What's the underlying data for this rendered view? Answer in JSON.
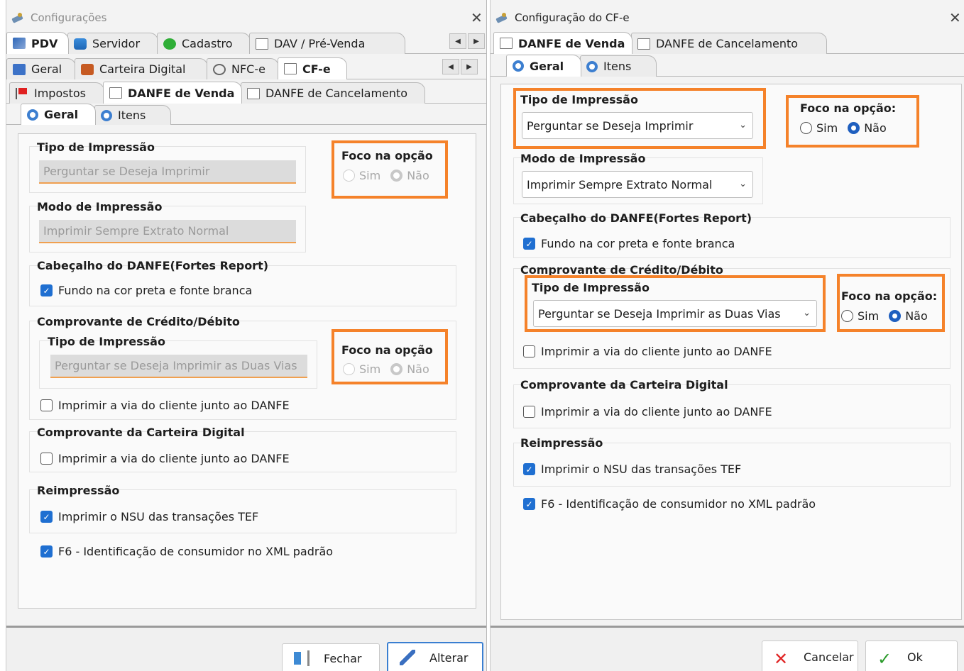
{
  "left": {
    "title": "Configurações",
    "close_glyph": "✕",
    "tabs_row1": [
      "PDV",
      "Servidor",
      "Cadastro",
      "DAV / Pré-Venda"
    ],
    "tabs_row2": [
      "Geral",
      "Carteira Digital",
      "NFC-e",
      "CF-e"
    ],
    "tabs_row3": [
      "Impostos",
      "DANFE de Venda",
      "DANFE de Cancelamento"
    ],
    "tabs_row4": [
      "Geral",
      "Itens"
    ],
    "tipo_impressao": {
      "label": "Tipo de Impressão",
      "value": "Perguntar se Deseja Imprimir"
    },
    "foco1": {
      "label": "Foco na opção",
      "sim": "Sim",
      "nao": "Não"
    },
    "modo_impressao": {
      "label": "Modo de Impressão",
      "value": "Imprimir Sempre Extrato Normal"
    },
    "cabecalho": {
      "label": "Cabeçalho do DANFE(Fortes Report)",
      "check": "Fundo na cor preta e fonte branca"
    },
    "credito": {
      "label": "Comprovante de Crédito/Débito",
      "tipo_label": "Tipo de Impressão",
      "tipo_value": "Perguntar se Deseja Imprimir as Duas Vias",
      "check": "Imprimir a via do cliente junto ao DANFE"
    },
    "foco2": {
      "label": "Foco na opção",
      "sim": "Sim",
      "nao": "Não"
    },
    "carteira": {
      "label": "Comprovante da Carteira Digital",
      "check": "Imprimir a via do cliente junto ao DANFE"
    },
    "reimpressao": {
      "label": "Reimpressão",
      "check": "Imprimir o NSU das transações TEF"
    },
    "f6": "F6 - Identificação de consumidor no XML padrão",
    "buttons": {
      "fechar": "Fechar",
      "alterar": "Alterar"
    }
  },
  "right": {
    "title": "Configuração do CF-e",
    "close_glyph": "✕",
    "tabs_row1": [
      "DANFE de Venda",
      "DANFE de Cancelamento"
    ],
    "tabs_row2": [
      "Geral",
      "Itens"
    ],
    "tipo_impressao": {
      "label": "Tipo de Impressão",
      "value": "Perguntar se Deseja Imprimir"
    },
    "foco1": {
      "label": "Foco na opção:",
      "sim": "Sim",
      "nao": "Não"
    },
    "modo_impressao": {
      "label": "Modo de Impressão",
      "value": "Imprimir Sempre Extrato Normal"
    },
    "cabecalho": {
      "label": "Cabeçalho do DANFE(Fortes Report)",
      "check": "Fundo na cor preta e fonte branca"
    },
    "credito": {
      "label": "Comprovante de Crédito/Débito",
      "tipo_label": "Tipo de Impressão",
      "tipo_value": "Perguntar se Deseja Imprimir as Duas Vias",
      "check": "Imprimir a via do cliente junto ao DANFE"
    },
    "foco2": {
      "label": "Foco na opção:",
      "sim": "Sim",
      "nao": "Não"
    },
    "carteira": {
      "label": "Comprovante da Carteira Digital",
      "check": "Imprimir a via do cliente junto ao DANFE"
    },
    "reimpressao": {
      "label": "Reimpressão",
      "check": "Imprimir o NSU das transações TEF"
    },
    "f6": "F6 - Identificação de consumidor no XML padrão",
    "buttons": {
      "cancelar": "Cancelar",
      "ok": "Ok"
    }
  },
  "colors": {
    "highlight": "#f5822a",
    "accent": "#1f6fd1"
  }
}
